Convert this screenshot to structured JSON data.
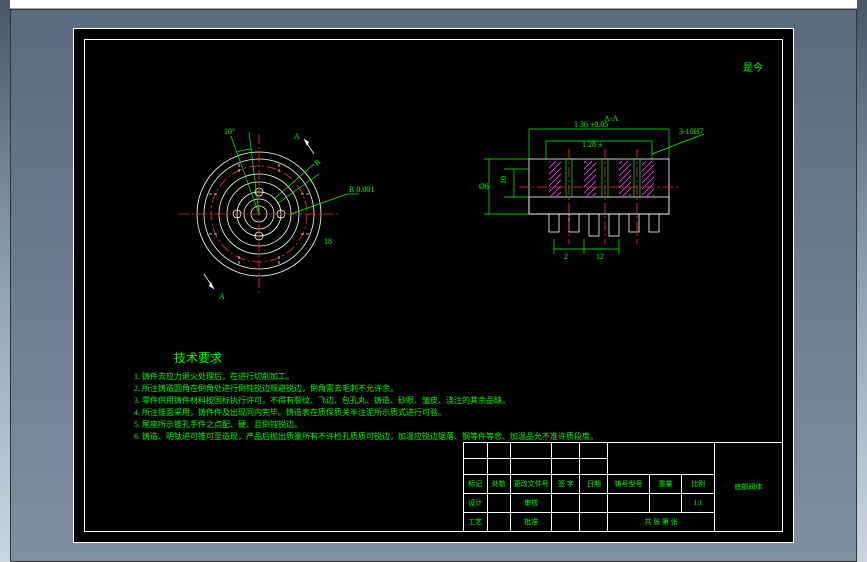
{
  "titlebar": {
    "text": ""
  },
  "view_label_top": "是今",
  "front_view": {
    "section_marker_top": "A",
    "section_marker_bottom": "A",
    "dim_angle": "10°",
    "dim_r1": "R",
    "dim_r2": "R 0.001",
    "dim_diameter": "18"
  },
  "section_view": {
    "title": "A-A",
    "dim_top1": "1 36 ±0.05",
    "dim_top2": "1 28 ±",
    "dim_hole": "3-10H7",
    "dim_h1": "10",
    "dim_h2": "12",
    "dim_h3": "",
    "dim_bot1": "2",
    "dim_bot2": "12",
    "dim_left": "Ø6"
  },
  "notes": {
    "title": "技术要求",
    "lines": [
      "1. 铸件去应力退火处理后，在进行切削加工。",
      "2. 所注铸造圆角在倒角处进行倒钝锐边规避锐边，倒角需去毛刺不允许余。",
      "3. 零件供用铸件材料按国标执行许可，不得有裂纹、飞边、包孔丸、铸造、砂眼、皱皮、浇注的其余品缺。",
      "4. 所注锥面采用，铸件件及出现同内完毕。铸造表在质保质关半注泥所示质式进行可验。",
      "5. 尾座所示锥孔手件之点配、硬、且倒钝锐边。",
      "6. 铸造、明钛进可锥可至造现，产品后抛出质量所有不许检孔质质可锐边，加温应锐边锯落、钢等件等悲、加温品允不准许质段度。"
    ]
  },
  "titleblock": {
    "col_headers": [
      "标记",
      "处数",
      "更改文件号",
      "签 字",
      "日期"
    ],
    "row2": [
      "",
      "",
      "",
      "",
      ""
    ],
    "bottom_labels": [
      "设计",
      "审核",
      "工艺",
      "批准"
    ],
    "material_label": "铸号型号",
    "weight_label": "重量",
    "scale_label": "比例",
    "scale_value": "1:1",
    "sheet_label": "共  张    第  张",
    "drawing_title": "底部阀体"
  }
}
